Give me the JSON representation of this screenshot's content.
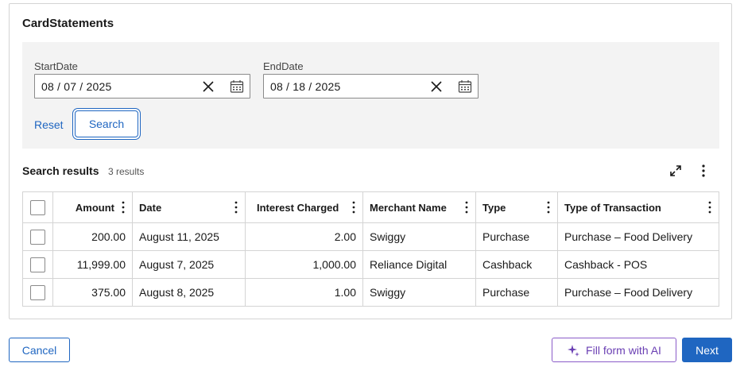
{
  "form": {
    "title": "CardStatements",
    "start_date": {
      "label": "StartDate",
      "value": "08 / 07 / 2025"
    },
    "end_date": {
      "label": "EndDate",
      "value": "08 / 18 / 2025"
    },
    "reset_label": "Reset",
    "search_label": "Search"
  },
  "results": {
    "title": "Search results",
    "count": "3 results",
    "columns": [
      "Amount",
      "Date",
      "Interest Charged",
      "Merchant Name",
      "Type",
      "Type of Transaction"
    ],
    "rows": [
      {
        "amount": "200.00",
        "date": "August 11, 2025",
        "interest": "2.00",
        "merchant": "Swiggy",
        "type": "Purchase",
        "transaction": "Purchase – Food Delivery"
      },
      {
        "amount": "11,999.00",
        "date": "August 7, 2025",
        "interest": "1,000.00",
        "merchant": "Reliance Digital",
        "type": "Cashback",
        "transaction": "Cashback - POS"
      },
      {
        "amount": "375.00",
        "date": "August 8, 2025",
        "interest": "1.00",
        "merchant": "Swiggy",
        "type": "Purchase",
        "transaction": "Purchase – Food Delivery"
      }
    ]
  },
  "footer": {
    "cancel_label": "Cancel",
    "ai_label": "Fill form with AI",
    "next_label": "Next"
  },
  "icons": {
    "clear": "close-icon",
    "calendar": "calendar-icon",
    "expand": "expand-icon",
    "more": "more-vertical-icon",
    "ai": "sparkle-icon"
  },
  "colors": {
    "primary": "#1f66c1",
    "ai_accent": "#8b5cc9",
    "panel_bg": "#f3f3f3"
  }
}
